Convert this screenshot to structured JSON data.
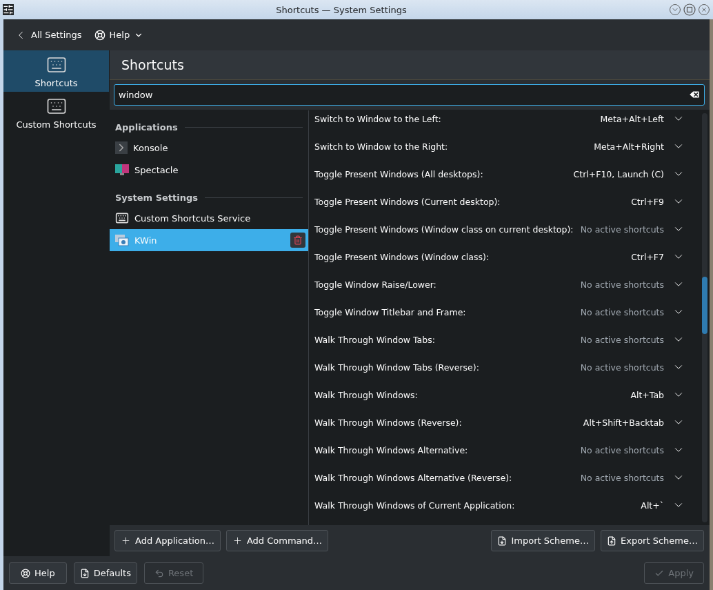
{
  "window": {
    "title": "Shortcuts — System Settings"
  },
  "toolbar": {
    "back": "All Settings",
    "help": "Help"
  },
  "sidebar": {
    "items": [
      {
        "label": "Shortcuts",
        "selected": true
      },
      {
        "label": "Custom Shortcuts",
        "selected": false
      }
    ]
  },
  "page": {
    "title": "Shortcuts"
  },
  "search": {
    "value": "window"
  },
  "components": {
    "groups": [
      {
        "title": "Applications",
        "items": [
          {
            "label": "Konsole",
            "kind": "terminal",
            "selected": false
          },
          {
            "label": "Spectacle",
            "kind": "screenshot",
            "selected": false
          }
        ]
      },
      {
        "title": "System Settings",
        "items": [
          {
            "label": "Custom Shortcuts Service",
            "kind": "keyboard",
            "selected": false
          },
          {
            "label": "KWin",
            "kind": "windows",
            "selected": true
          }
        ]
      }
    ]
  },
  "shortcuts": [
    {
      "action": "Switch to Window to the Left:",
      "keys": "Meta+Alt+Left",
      "active": true
    },
    {
      "action": "Switch to Window to the Right:",
      "keys": "Meta+Alt+Right",
      "active": true
    },
    {
      "action": "Toggle Present Windows (All desktops):",
      "keys": "Ctrl+F10, Launch (C)",
      "active": true
    },
    {
      "action": "Toggle Present Windows (Current desktop):",
      "keys": "Ctrl+F9",
      "active": true
    },
    {
      "action": "Toggle Present Windows (Window class on current desktop):",
      "keys": "No active shortcuts",
      "active": false
    },
    {
      "action": "Toggle Present Windows (Window class):",
      "keys": "Ctrl+F7",
      "active": true
    },
    {
      "action": "Toggle Window Raise/Lower:",
      "keys": "No active shortcuts",
      "active": false
    },
    {
      "action": "Toggle Window Titlebar and Frame:",
      "keys": "No active shortcuts",
      "active": false
    },
    {
      "action": "Walk Through Window Tabs:",
      "keys": "No active shortcuts",
      "active": false
    },
    {
      "action": "Walk Through Window Tabs (Reverse):",
      "keys": "No active shortcuts",
      "active": false
    },
    {
      "action": "Walk Through Windows:",
      "keys": "Alt+Tab",
      "active": true
    },
    {
      "action": "Walk Through Windows (Reverse):",
      "keys": "Alt+Shift+Backtab",
      "active": true
    },
    {
      "action": "Walk Through Windows Alternative:",
      "keys": "No active shortcuts",
      "active": false
    },
    {
      "action": "Walk Through Windows Alternative (Reverse):",
      "keys": "No active shortcuts",
      "active": false
    },
    {
      "action": "Walk Through Windows of Current Application:",
      "keys": "Alt+`",
      "active": true
    }
  ],
  "list_buttons": {
    "add": [
      "Add Application…",
      "Add Command…"
    ],
    "scheme": [
      "Import Scheme…",
      "Export Scheme…"
    ]
  },
  "footer": {
    "help": "Help",
    "defaults": "Defaults",
    "reset": {
      "label": "Reset",
      "disabled": true
    },
    "apply": {
      "label": "Apply",
      "disabled": true
    }
  }
}
